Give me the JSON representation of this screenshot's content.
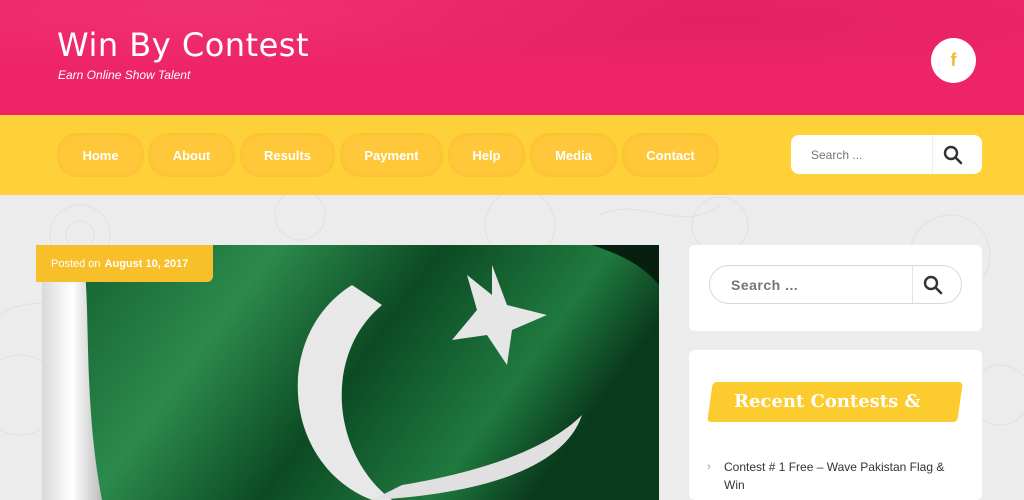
{
  "header": {
    "site_title": "Win By Contest",
    "tagline": "Earn Online Show Talent",
    "facebook_glyph": "f"
  },
  "nav": {
    "items": [
      {
        "label": "Home"
      },
      {
        "label": "About"
      },
      {
        "label": "Results"
      },
      {
        "label": "Payment"
      },
      {
        "label": "Help"
      },
      {
        "label": "Media"
      },
      {
        "label": "Contact"
      }
    ],
    "search_placeholder": "Search ..."
  },
  "post": {
    "posted_on_label": "Posted on",
    "date": "August 10, 2017"
  },
  "sidebar": {
    "search_placeholder": "Search ...",
    "recent_title": "Recent Contests & P",
    "recent_items": [
      {
        "label": "Contest # 1 Free – Wave Pakistan Flag & Win"
      }
    ]
  },
  "colors": {
    "header_bg": "#ee2468",
    "nav_bg": "#fed138",
    "accent": "#f7bf2a"
  }
}
